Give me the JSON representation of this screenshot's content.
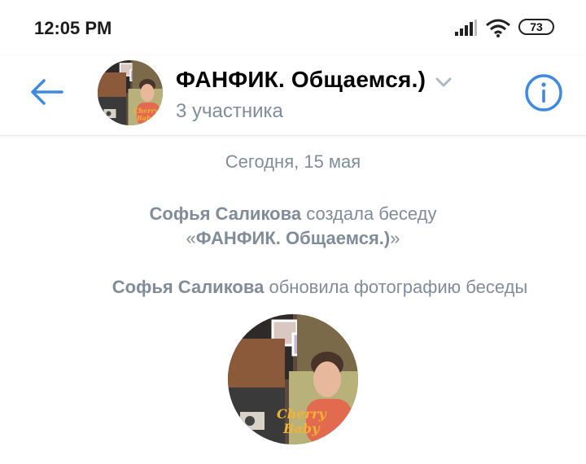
{
  "status_bar": {
    "time": "12:05 PM",
    "battery": "73",
    "icons": [
      "signal-icon",
      "wifi-icon",
      "battery-icon"
    ]
  },
  "header": {
    "title": "ФАНФИК. Общаемся.)",
    "subtitle": "3 участника",
    "avatar_text_line1": "Cherry",
    "avatar_text_line2": "Baby",
    "accent_color": "#3f8ae0",
    "icons": [
      "back-arrow-icon",
      "chevron-down-icon",
      "info-icon"
    ]
  },
  "chat": {
    "date": "Сегодня, 15 мая",
    "events": [
      {
        "author": "Софья Саликова",
        "action": "создала беседу",
        "quote_open": "«",
        "conversation_name": "ФАНФИК. Общаемся.)",
        "quote_close": "»"
      },
      {
        "author": "Софья Саликова",
        "action": "обновила фотографию беседы"
      }
    ],
    "photo_text_line1": "Cherry",
    "photo_text_line2": "Baby"
  },
  "colors": {
    "secondary_text": "#818c99",
    "background": "#ffffff"
  }
}
